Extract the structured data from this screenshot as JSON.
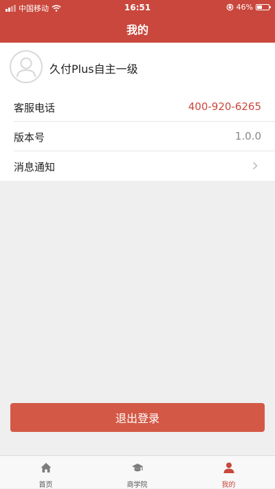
{
  "status_bar": {
    "carrier": "中国移动",
    "time": "16:51",
    "battery": "46%",
    "battery_level": 0.46
  },
  "header": {
    "title": "我的"
  },
  "profile": {
    "name": "久付Plus自主一级"
  },
  "rows": [
    {
      "label": "客服电话",
      "value": "400-920-6265"
    },
    {
      "label": "版本号",
      "value": "1.0.0"
    },
    {
      "label": "消息通知",
      "value": ""
    }
  ],
  "logout": {
    "label": "退出登录"
  },
  "tabbar": {
    "tabs": [
      {
        "label": "首页",
        "icon": "home-icon"
      },
      {
        "label": "商学院",
        "icon": "graduation-cap-icon"
      },
      {
        "label": "我的",
        "icon": "user-icon",
        "active": true
      }
    ]
  },
  "colors": {
    "brand": "#c9473c",
    "button": "#d35946",
    "phone": "#c9473c",
    "muted": "#888888"
  }
}
